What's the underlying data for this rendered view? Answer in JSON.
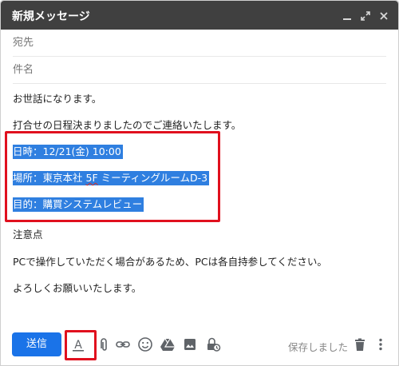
{
  "window": {
    "title": "新規メッセージ",
    "accent": "#1a73e8",
    "highlight_color": "#2f7fe0",
    "annotation_color": "#e0101e"
  },
  "header_icons": [
    "minimize-icon",
    "expand-icon",
    "close-icon"
  ],
  "fields": {
    "to_placeholder": "宛先",
    "subject_placeholder": "件名"
  },
  "body": {
    "greeting": "お世話になります。",
    "intro": "打合せの日程決まりましたのでご連絡いたします。",
    "datetime": "日時：12/21(金) 10:00",
    "place_prefix": "場所：東京本社",
    "place_floor": "5F",
    "place_suffix": "ミーティングルームD-3",
    "purpose": "目的：購買システムレビュー",
    "notice_heading": "注意点",
    "notice_text": "PCで操作していただく場合があるため、PCは各自持参してください。",
    "closing": "よろしくお願いいたします。"
  },
  "toolbar": {
    "send_label": "送信",
    "format_label": "A",
    "saved_label": "保存しました",
    "icons": [
      "text-format-icon",
      "attach-icon",
      "link-icon",
      "emoji-icon",
      "drive-icon",
      "image-icon",
      "confidential-icon",
      "trash-icon",
      "more-options-icon"
    ]
  }
}
